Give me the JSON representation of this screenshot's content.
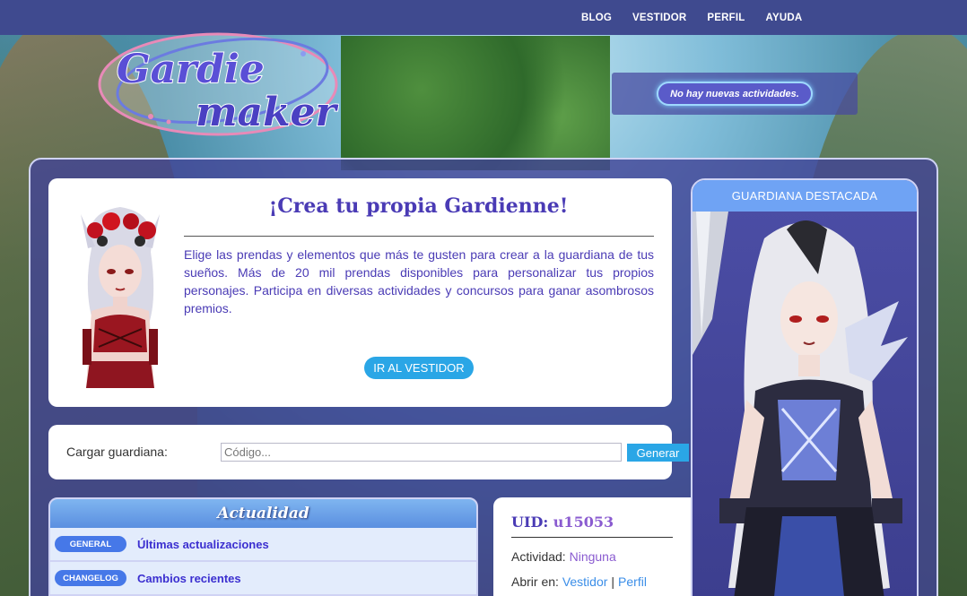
{
  "nav": {
    "items": [
      "BLOG",
      "VESTIDOR",
      "PERFIL",
      "AYUDA"
    ]
  },
  "logo": {
    "line1": "Gardie",
    "line2": "maker"
  },
  "notifications": {
    "text": "No hay nuevas actividades."
  },
  "hero": {
    "title": "¡Crea tu propia Gardienne!",
    "description": "Elige las prendas y elementos que más te gusten para crear a la guardiana de tus sueños. Más de 20 mil prendas disponibles para personalizar tus propios personajes. Participa en diversas actividades y concursos para ganar asombrosos premios.",
    "button": "IR AL VESTIDOR"
  },
  "load": {
    "label": "Cargar guardiana:",
    "placeholder": "Código...",
    "button": "Generar"
  },
  "news": {
    "title": "Actualidad",
    "rows": [
      {
        "badge": "GENERAL",
        "link": "Últimas actualizaciones"
      },
      {
        "badge": "CHANGELOG",
        "link": "Cambios recientes"
      }
    ]
  },
  "user": {
    "uid_label": "UID:",
    "uid_value": "u15053",
    "activity_label": "Actividad:",
    "activity_value": "Ninguna",
    "open_label": "Abrir en:",
    "open_links": [
      "Vestidor",
      "Perfil"
    ],
    "separator": "|"
  },
  "featured": {
    "title": "GUARDIANA DESTACADA"
  },
  "colors": {
    "nav_bg": "#3f4a8f",
    "accent": "#2aa6e6",
    "title_purple": "#4a3bb5",
    "frame_bg": "#424496"
  }
}
